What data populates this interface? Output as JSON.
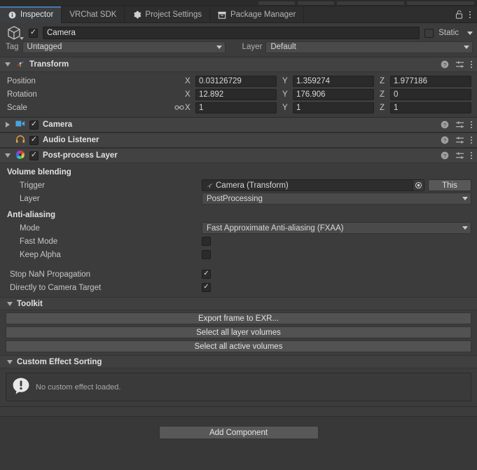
{
  "window": {
    "tabs": [
      {
        "label": "Inspector",
        "icon": "info-icon",
        "active": true
      },
      {
        "label": "VRChat SDK",
        "icon": "",
        "active": false
      },
      {
        "label": "Project Settings",
        "icon": "gear-icon",
        "active": false
      },
      {
        "label": "Package Manager",
        "icon": "package-icon",
        "active": false
      }
    ],
    "lock_icon": "unlocked-padlock-icon",
    "menu_icon": "kebab-menu-icon"
  },
  "gameobject": {
    "icon": "cube-icon",
    "enabled": true,
    "name": "Camera",
    "static_label": "Static",
    "static_checked": false,
    "tag_label": "Tag",
    "tag_value": "Untagged",
    "layer_label": "Layer",
    "layer_value": "Default"
  },
  "transform": {
    "title": "Transform",
    "icon": "transform-axis-icon",
    "expanded": true,
    "axes": [
      "X",
      "Y",
      "Z"
    ],
    "rows": [
      {
        "label": "Position",
        "values": [
          "0.03126729",
          "1.359274",
          "1.977186"
        ],
        "link": false
      },
      {
        "label": "Rotation",
        "values": [
          "12.892",
          "176.906",
          "0"
        ],
        "link": false
      },
      {
        "label": "Scale",
        "values": [
          "1",
          "1",
          "1"
        ],
        "link": true
      }
    ]
  },
  "components": [
    {
      "name": "Camera",
      "icon": "camera-icon",
      "enabled": true,
      "expanded": false
    },
    {
      "name": "Audio Listener",
      "icon": "headphones-icon",
      "enabled": true,
      "expanded": false
    }
  ],
  "postprocess": {
    "title": "Post-process Layer",
    "icon": "aperture-icon",
    "enabled": true,
    "expanded": true,
    "volume_blending": {
      "title": "Volume blending",
      "trigger_label": "Trigger",
      "trigger_value": "Camera (Transform)",
      "trigger_icon": "transform-axis-icon",
      "picker_icon": "object-picker-icon",
      "this_button": "This",
      "layer_label": "Layer",
      "layer_value": "PostProcessing"
    },
    "antialiasing": {
      "title": "Anti-aliasing",
      "mode_label": "Mode",
      "mode_value": "Fast Approximate Anti-aliasing (FXAA)",
      "fast_mode_label": "Fast Mode",
      "fast_mode_checked": false,
      "keep_alpha_label": "Keep Alpha",
      "keep_alpha_checked": false
    },
    "stop_nan_label": "Stop NaN Propagation",
    "stop_nan_checked": true,
    "direct_target_label": "Directly to Camera Target",
    "direct_target_checked": true,
    "toolkit": {
      "title": "Toolkit",
      "buttons": [
        "Export frame to EXR...",
        "Select all layer volumes",
        "Select all active volumes"
      ]
    },
    "custom_sorting": {
      "title": "Custom Effect Sorting",
      "info_icon": "info-bubble-icon",
      "info_text": "No custom effect loaded."
    }
  },
  "footer": {
    "add_component": "Add Component"
  },
  "colors": {
    "accent": "#4a78b5",
    "panel": "#3c3c3c",
    "header": "#424242",
    "field": "#2a2a2a"
  }
}
